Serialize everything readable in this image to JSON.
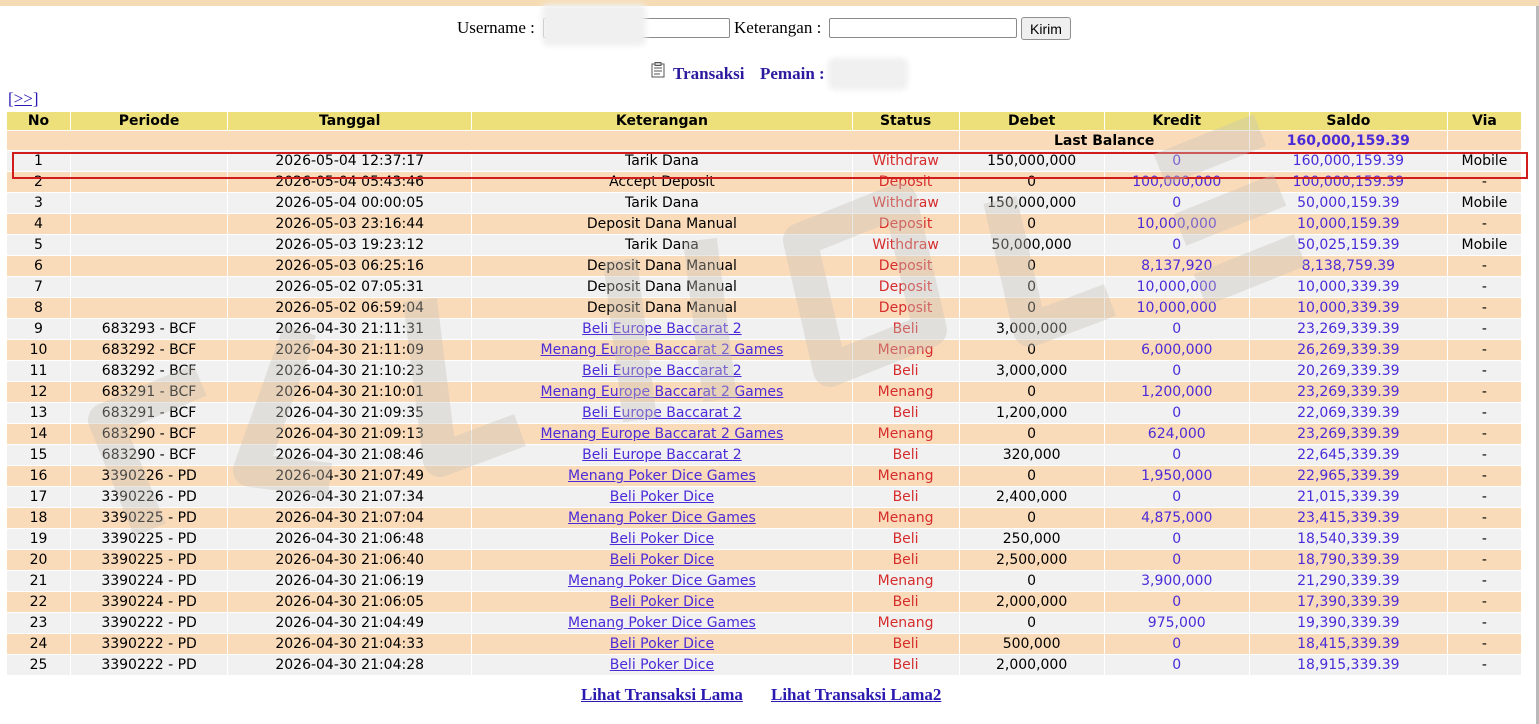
{
  "form": {
    "username_label": "Username :",
    "keterangan_label": "Keterangan :",
    "submit_label": "Kirim"
  },
  "heading": {
    "transaksi": "Transaksi",
    "pemain": "Pemain :"
  },
  "nav": {
    "next_label": "[>>]"
  },
  "table": {
    "headers": [
      "No",
      "Periode",
      "Tanggal",
      "Keterangan",
      "Status",
      "Debet",
      "Kredit",
      "Saldo",
      "Via"
    ],
    "last_balance_label": "Last Balance",
    "last_balance_value": "160,000,159.39",
    "rows": [
      {
        "no": "1",
        "periode": "",
        "tanggal": "2026-05-04 12:37:17",
        "keterangan": "Tarik Dana",
        "link": false,
        "status": "Withdraw",
        "debet": "150,000,000",
        "kredit": "0",
        "saldo": "160,000,159.39",
        "via": "Mobile"
      },
      {
        "no": "2",
        "periode": "",
        "tanggal": "2026-05-04 05:43:46",
        "keterangan": "Accept Deposit",
        "link": false,
        "status": "Deposit",
        "debet": "0",
        "kredit": "100,000,000",
        "saldo": "100,000,159.39",
        "via": "-"
      },
      {
        "no": "3",
        "periode": "",
        "tanggal": "2026-05-04 00:00:05",
        "keterangan": "Tarik Dana",
        "link": false,
        "status": "Withdraw",
        "debet": "150,000,000",
        "kredit": "0",
        "saldo": "50,000,159.39",
        "via": "Mobile"
      },
      {
        "no": "4",
        "periode": "",
        "tanggal": "2026-05-03 23:16:44",
        "keterangan": "Deposit Dana Manual",
        "link": false,
        "status": "Deposit",
        "debet": "0",
        "kredit": "10,000,000",
        "saldo": "10,000,159.39",
        "via": "-"
      },
      {
        "no": "5",
        "periode": "",
        "tanggal": "2026-05-03 19:23:12",
        "keterangan": "Tarik Dana",
        "link": false,
        "status": "Withdraw",
        "debet": "50,000,000",
        "kredit": "0",
        "saldo": "50,025,159.39",
        "via": "Mobile"
      },
      {
        "no": "6",
        "periode": "",
        "tanggal": "2026-05-03 06:25:16",
        "keterangan": "Deposit Dana Manual",
        "link": false,
        "status": "Deposit",
        "debet": "0",
        "kredit": "8,137,920",
        "saldo": "8,138,759.39",
        "via": "-"
      },
      {
        "no": "7",
        "periode": "",
        "tanggal": "2026-05-02 07:05:31",
        "keterangan": "Deposit Dana Manual",
        "link": false,
        "status": "Deposit",
        "debet": "0",
        "kredit": "10,000,000",
        "saldo": "10,000,339.39",
        "via": "-"
      },
      {
        "no": "8",
        "periode": "",
        "tanggal": "2026-05-02 06:59:04",
        "keterangan": "Deposit Dana Manual",
        "link": false,
        "status": "Deposit",
        "debet": "0",
        "kredit": "10,000,000",
        "saldo": "10,000,339.39",
        "via": "-"
      },
      {
        "no": "9",
        "periode": "683293 - BCF",
        "tanggal": "2026-04-30 21:11:31",
        "keterangan": "Beli Europe Baccarat 2",
        "link": true,
        "status": "Beli",
        "debet": "3,000,000",
        "kredit": "0",
        "saldo": "23,269,339.39",
        "via": "-"
      },
      {
        "no": "10",
        "periode": "683292 - BCF",
        "tanggal": "2026-04-30 21:11:09",
        "keterangan": "Menang Europe Baccarat 2 Games",
        "link": true,
        "status": "Menang",
        "debet": "0",
        "kredit": "6,000,000",
        "saldo": "26,269,339.39",
        "via": "-"
      },
      {
        "no": "11",
        "periode": "683292 - BCF",
        "tanggal": "2026-04-30 21:10:23",
        "keterangan": "Beli Europe Baccarat 2",
        "link": true,
        "status": "Beli",
        "debet": "3,000,000",
        "kredit": "0",
        "saldo": "20,269,339.39",
        "via": "-"
      },
      {
        "no": "12",
        "periode": "683291 - BCF",
        "tanggal": "2026-04-30 21:10:01",
        "keterangan": "Menang Europe Baccarat 2 Games",
        "link": true,
        "status": "Menang",
        "debet": "0",
        "kredit": "1,200,000",
        "saldo": "23,269,339.39",
        "via": "-"
      },
      {
        "no": "13",
        "periode": "683291 - BCF",
        "tanggal": "2026-04-30 21:09:35",
        "keterangan": "Beli Europe Baccarat 2",
        "link": true,
        "status": "Beli",
        "debet": "1,200,000",
        "kredit": "0",
        "saldo": "22,069,339.39",
        "via": "-"
      },
      {
        "no": "14",
        "periode": "683290 - BCF",
        "tanggal": "2026-04-30 21:09:13",
        "keterangan": "Menang Europe Baccarat 2 Games",
        "link": true,
        "status": "Menang",
        "debet": "0",
        "kredit": "624,000",
        "saldo": "23,269,339.39",
        "via": "-"
      },
      {
        "no": "15",
        "periode": "683290 - BCF",
        "tanggal": "2026-04-30 21:08:46",
        "keterangan": "Beli Europe Baccarat 2",
        "link": true,
        "status": "Beli",
        "debet": "320,000",
        "kredit": "0",
        "saldo": "22,645,339.39",
        "via": "-"
      },
      {
        "no": "16",
        "periode": "3390226 - PD",
        "tanggal": "2026-04-30 21:07:49",
        "keterangan": "Menang Poker Dice Games",
        "link": true,
        "status": "Menang",
        "debet": "0",
        "kredit": "1,950,000",
        "saldo": "22,965,339.39",
        "via": "-"
      },
      {
        "no": "17",
        "periode": "3390226 - PD",
        "tanggal": "2026-04-30 21:07:34",
        "keterangan": "Beli Poker Dice",
        "link": true,
        "status": "Beli",
        "debet": "2,400,000",
        "kredit": "0",
        "saldo": "21,015,339.39",
        "via": "-"
      },
      {
        "no": "18",
        "periode": "3390225 - PD",
        "tanggal": "2026-04-30 21:07:04",
        "keterangan": "Menang Poker Dice Games",
        "link": true,
        "status": "Menang",
        "debet": "0",
        "kredit": "4,875,000",
        "saldo": "23,415,339.39",
        "via": "-"
      },
      {
        "no": "19",
        "periode": "3390225 - PD",
        "tanggal": "2026-04-30 21:06:48",
        "keterangan": "Beli Poker Dice",
        "link": true,
        "status": "Beli",
        "debet": "250,000",
        "kredit": "0",
        "saldo": "18,540,339.39",
        "via": "-"
      },
      {
        "no": "20",
        "periode": "3390225 - PD",
        "tanggal": "2026-04-30 21:06:40",
        "keterangan": "Beli Poker Dice",
        "link": true,
        "status": "Beli",
        "debet": "2,500,000",
        "kredit": "0",
        "saldo": "18,790,339.39",
        "via": "-"
      },
      {
        "no": "21",
        "periode": "3390224 - PD",
        "tanggal": "2026-04-30 21:06:19",
        "keterangan": "Menang Poker Dice Games",
        "link": true,
        "status": "Menang",
        "debet": "0",
        "kredit": "3,900,000",
        "saldo": "21,290,339.39",
        "via": "-"
      },
      {
        "no": "22",
        "periode": "3390224 - PD",
        "tanggal": "2026-04-30 21:06:05",
        "keterangan": "Beli Poker Dice",
        "link": true,
        "status": "Beli",
        "debet": "2,000,000",
        "kredit": "0",
        "saldo": "17,390,339.39",
        "via": "-"
      },
      {
        "no": "23",
        "periode": "3390222 - PD",
        "tanggal": "2026-04-30 21:04:49",
        "keterangan": "Menang Poker Dice Games",
        "link": true,
        "status": "Menang",
        "debet": "0",
        "kredit": "975,000",
        "saldo": "19,390,339.39",
        "via": "-"
      },
      {
        "no": "24",
        "periode": "3390222 - PD",
        "tanggal": "2026-04-30 21:04:33",
        "keterangan": "Beli Poker Dice",
        "link": true,
        "status": "Beli",
        "debet": "500,000",
        "kredit": "0",
        "saldo": "18,415,339.39",
        "via": "-"
      },
      {
        "no": "25",
        "periode": "3390222 - PD",
        "tanggal": "2026-04-30 21:04:28",
        "keterangan": "Beli Poker Dice",
        "link": true,
        "status": "Beli",
        "debet": "2,000,000",
        "kredit": "0",
        "saldo": "18,915,339.39",
        "via": "-"
      }
    ]
  },
  "footer": {
    "link1": "Lihat Transaksi Lama",
    "link2": "Lihat Transaksi Lama2"
  },
  "colors": {
    "header_bg": "#ede07a",
    "row_odd": "#f1f1f1",
    "row_even": "#fadbb9",
    "status_red": "#d62c2c",
    "value_purple": "#4b2bd8",
    "highlight_red": "#d21c1c"
  }
}
